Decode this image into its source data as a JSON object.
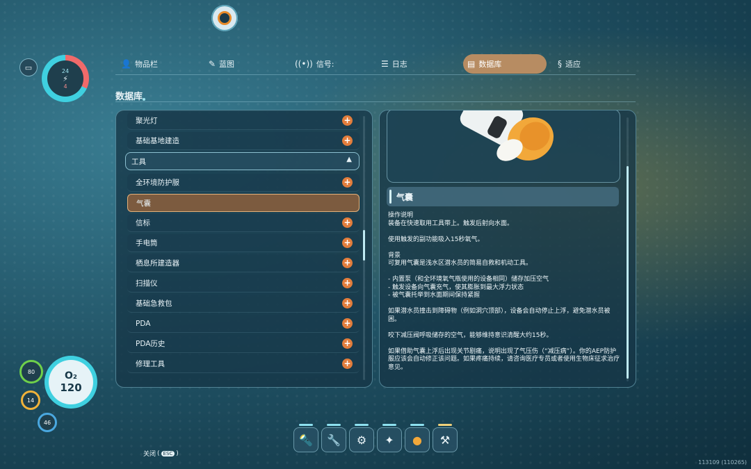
{
  "hud": {
    "battery_icon": "battery-icon",
    "vitals_top": "24",
    "vitals_bottom": "4",
    "oxygen_label": "O₂",
    "oxygen_value": "120",
    "health": "80",
    "food": "14",
    "water": "46"
  },
  "tabs": [
    {
      "label": "物品栏",
      "icon": "person-icon"
    },
    {
      "label": "蓝图",
      "icon": "blueprint-icon"
    },
    {
      "label": "信号:",
      "icon": "signal-icon"
    },
    {
      "label": "日志",
      "icon": "log-icon"
    },
    {
      "label": "数据库",
      "icon": "database-icon",
      "active": true
    },
    {
      "label": "适应",
      "icon": "dna-icon"
    }
  ],
  "page_title": "数据库",
  "list": {
    "items_before": [
      "聚光灯",
      "基础基地建造"
    ],
    "category": "工具",
    "items_after": [
      "全环境防护服",
      "气囊",
      "信标",
      "手电筒",
      "栖息所建造器",
      "扫描仪",
      "基础急救包",
      "PDA",
      "PDA历史",
      "修理工具"
    ],
    "selected": "气囊"
  },
  "entry": {
    "title": "气囊",
    "body": "操作说明\n装备在快速取用工具带上。触发后射向水面。\n\n使用触发的副功能吸入15秒氧气。\n\n背景\n可复用气囊是浅水区潜水员的简易自救和机动工具。\n\n- 内置泵（和全环境氧气瓶使用的设备相同）储存加压空气\n- 触发设备向气囊充气，使其膨胀到最大浮力状态\n- 被气囊托举到水面期间保持紧握\n\n如果潜水员撞击到障碍物（例如洞穴顶部），设备会自动停止上浮，避免潜水员被困。\n\n咬下减压阀呼吸储存的空气，能够维持意识清醒大约15秒。\n\n如果借助气囊上浮后出现关节剧痛，说明出现了气压伤（“减压病”）。你的AEP防护服应该会自动修正该问题。如果疼痛持续，请咨询医疗专员或者使用生物床征求治疗意见。"
  },
  "quickbar": [
    "scanner-tool-icon",
    "repair-tool-icon",
    "builder-tool-icon",
    "flashlight-icon",
    "air-bladder-icon",
    "habitat-builder-icon"
  ],
  "close_label": "关闭",
  "esc_label": "ESC",
  "version": "113109 (110265)",
  "colors": {
    "accent": "#b78c62",
    "plus": "#e27d3c",
    "oxygen": "#3fd0e0"
  }
}
